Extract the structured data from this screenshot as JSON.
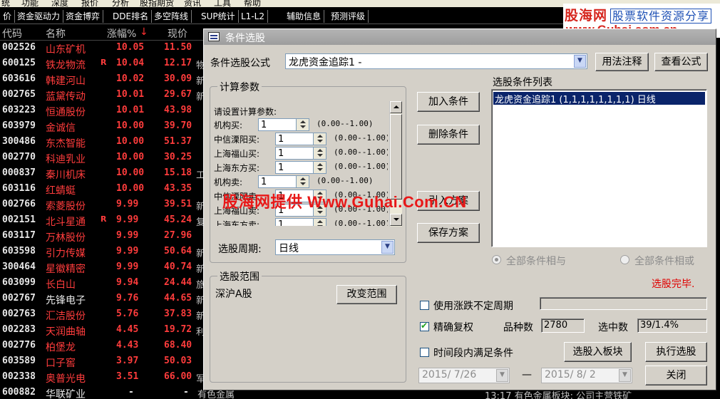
{
  "menubar": [
    "统",
    "功能",
    "深度",
    "报价",
    "分析",
    "股指期货",
    "资讯",
    "工具",
    "帮助"
  ],
  "toolbar": [
    "价",
    "资金驱动力",
    "资金博弈",
    "DDE排名",
    "多空阵线",
    "SUP统计",
    "L1-L2",
    "辅助信息",
    "预测评级"
  ],
  "watermark_top": {
    "brand": "股海网",
    "slogan": "股票软件资源分享",
    "url": "www.Guhai.com.cn"
  },
  "watermark_mid": "股海网提供 Www.Guhai.Com.CN",
  "columns": {
    "code": "代码",
    "name": "名称",
    "pct": "涨幅%",
    "sort_arrow": "↓",
    "price": "现价"
  },
  "stocks": [
    {
      "code": "002526",
      "name": "山东矿机",
      "flag": "",
      "pct": "10.05",
      "price": "11.50",
      "edge": ""
    },
    {
      "code": "600125",
      "name": "铁龙物流",
      "flag": "R",
      "pct": "10.04",
      "price": "12.17",
      "edge": "物"
    },
    {
      "code": "603616",
      "name": "韩建河山",
      "flag": "",
      "pct": "10.02",
      "price": "30.09",
      "edge": "新"
    },
    {
      "code": "002765",
      "name": "蓝黛传动",
      "flag": "",
      "pct": "10.01",
      "price": "29.67",
      "edge": "新"
    },
    {
      "code": "603223",
      "name": "恒通股份",
      "flag": "",
      "pct": "10.01",
      "price": "43.98",
      "edge": ""
    },
    {
      "code": "603979",
      "name": "金诚信",
      "flag": "",
      "pct": "10.00",
      "price": "39.70",
      "edge": ""
    },
    {
      "code": "300486",
      "name": "东杰智能",
      "flag": "",
      "pct": "10.00",
      "price": "51.37",
      "edge": ""
    },
    {
      "code": "002770",
      "name": "科迪乳业",
      "flag": "",
      "pct": "10.00",
      "price": "30.25",
      "edge": ""
    },
    {
      "code": "000837",
      "name": "秦川机床",
      "flag": "",
      "pct": "10.00",
      "price": "15.18",
      "edge": "工"
    },
    {
      "code": "603116",
      "name": "红蜻蜓",
      "flag": "",
      "pct": "10.00",
      "price": "43.35",
      "edge": ""
    },
    {
      "code": "002766",
      "name": "索菱股份",
      "flag": "",
      "pct": "9.99",
      "price": "39.51",
      "edge": "新"
    },
    {
      "code": "002151",
      "name": "北斗星通",
      "flag": "R",
      "pct": "9.99",
      "price": "45.24",
      "edge": "复"
    },
    {
      "code": "603117",
      "name": "万林股份",
      "flag": "",
      "pct": "9.99",
      "price": "27.96",
      "edge": ""
    },
    {
      "code": "603598",
      "name": "引力传媒",
      "flag": "",
      "pct": "9.99",
      "price": "50.64",
      "edge": "新"
    },
    {
      "code": "300464",
      "name": "星徽精密",
      "flag": "",
      "pct": "9.99",
      "price": "40.74",
      "edge": "新"
    },
    {
      "code": "603099",
      "name": "长白山",
      "flag": "",
      "pct": "9.94",
      "price": "24.44",
      "edge": "旅"
    },
    {
      "code": "002767",
      "name": "先锋电子",
      "flag": "",
      "pct": "9.76",
      "price": "44.65",
      "edge": "新",
      "white_name": true
    },
    {
      "code": "002763",
      "name": "汇洁股份",
      "flag": "",
      "pct": "5.76",
      "price": "37.83",
      "edge": "新"
    },
    {
      "code": "002283",
      "name": "天润曲轴",
      "flag": "",
      "pct": "4.45",
      "price": "19.72",
      "edge": "利"
    },
    {
      "code": "002776",
      "name": "柏堡龙",
      "flag": "",
      "pct": "4.43",
      "price": "68.40",
      "edge": ""
    },
    {
      "code": "603589",
      "name": "口子窖",
      "flag": "",
      "pct": "3.97",
      "price": "50.03",
      "edge": ""
    },
    {
      "code": "002338",
      "name": "奥普光电",
      "flag": "",
      "pct": "3.51",
      "price": "66.00",
      "edge": "军"
    },
    {
      "code": "600882",
      "name": "华联矿业",
      "flag": "",
      "pct": "-",
      "price": "-",
      "edge": "有色金属",
      "white_name": true,
      "white_vals": true
    }
  ],
  "bottom_bar": {
    "time": "13:17",
    "text": "有色金属板块: 公司主营铁矿"
  },
  "dialog": {
    "title": "条件选股",
    "formula_label": "条件选股公式",
    "formula_value": "龙虎资金追踪1 -",
    "btn_usage": "用法注释",
    "btn_view": "查看公式",
    "params_group": "计算参数",
    "params_hint": "请设置计算参数:",
    "params": [
      {
        "label": "机构买:",
        "value": "1",
        "range": "(0.00--1.00)"
      },
      {
        "label": "中信溧阳买:",
        "value": "1",
        "range": "(0.00--1.00)"
      },
      {
        "label": "上海福山买:",
        "value": "1",
        "range": "(0.00--1.00)"
      },
      {
        "label": "上海东方买:",
        "value": "1",
        "range": "(0.00--1.00)"
      },
      {
        "label": "机构卖:",
        "value": "1",
        "range": "(0.00--1.00)"
      },
      {
        "label": "中信溧阳卖:",
        "value": "1",
        "range": "(0.00--1.00)"
      },
      {
        "label": "上海福山卖:",
        "value": "1",
        "range": "(0.00--1.00)"
      },
      {
        "label": "上海东方卖:",
        "value": "1",
        "range": "(0.00--1.00)"
      }
    ],
    "period_label": "选股周期:",
    "period_value": "日线",
    "btn_add": "加入条件",
    "btn_delete": "删除条件",
    "btn_load": "引入方案",
    "btn_save": "保存方案",
    "list_label": "选股条件列表",
    "list_items": [
      "龙虎资金追踪1 (1,1,1,1,1,1,1,1) 日线"
    ],
    "radio_and": "全部条件相与",
    "radio_or": "全部条件相或",
    "status": "选股完毕.",
    "range_group": "选股范围",
    "range_value": "深沪A股",
    "btn_range": "改变范围",
    "chk_variable_period": "使用涨跌不定周期",
    "chk_exact_rights": "精确复权",
    "count_label": "品种数",
    "count_value": "2780",
    "selected_label": "选中数",
    "selected_value": "39/1.4%",
    "chk_time_range": "时间段内满足条件",
    "btn_to_block": "选股入板块",
    "btn_run": "执行选股",
    "date_from": "2015/ 7/26",
    "date_sep": "—",
    "date_to": "2015/ 8/ 2",
    "btn_close": "关闭"
  },
  "colors": {
    "up_red": "#ff3c3c",
    "title_bar": "#a8a8a8",
    "selection": "#0a246a",
    "dialog_bg": "#d4d0c8"
  }
}
